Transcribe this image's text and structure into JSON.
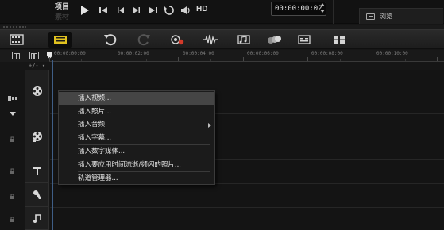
{
  "colors": {
    "accent": "#e1c21f",
    "playhead": "#3f5e86",
    "background": "#161616",
    "menu_hover": "#454545"
  },
  "top_bar": {
    "mode_label": "项目",
    "mode_label_sub": "素材",
    "hd_label": "HD",
    "timecode": "00:00:00:02",
    "browse_label": "浏览",
    "controls": [
      {
        "icon": "play-icon"
      },
      {
        "icon": "go-to-start-icon"
      },
      {
        "icon": "previous-frame-icon"
      },
      {
        "icon": "next-frame-icon"
      },
      {
        "icon": "go-to-end-icon"
      },
      {
        "icon": "repeat-icon"
      },
      {
        "icon": "volume-icon"
      }
    ]
  },
  "toolbar": {
    "items": [
      {
        "icon": "storyboard-view-icon",
        "active": false
      },
      {
        "icon": "timeline-view-icon",
        "active": true
      },
      {
        "icon": "undo-icon",
        "active": false
      },
      {
        "icon": "redo-icon",
        "active": false
      },
      {
        "icon": "record-capture-icon",
        "active": false
      },
      {
        "icon": "audio-mixer-icon",
        "active": false
      },
      {
        "icon": "auto-music-icon",
        "active": false
      },
      {
        "icon": "motion-track-icon",
        "active": false
      },
      {
        "icon": "subtitle-editor-icon",
        "active": false
      },
      {
        "icon": "multi-camera-icon",
        "active": false
      }
    ]
  },
  "ruler": {
    "zoom_hint": "+/- ▾",
    "ticks": [
      "00:00:00:00",
      "00:00:02:00",
      "00:00:04:00",
      "00:00:06:00",
      "00:00:08:00",
      "00:00:10:00"
    ]
  },
  "tracks": [
    {
      "icon": "video-track-icon"
    },
    {
      "icon": "overlay-track-icon"
    },
    {
      "icon": "title-track-icon"
    },
    {
      "icon": "voice-track-icon"
    },
    {
      "icon": "music-track-icon"
    }
  ],
  "context_menu": {
    "items": [
      {
        "label": "插入视频...",
        "hover": true
      },
      {
        "label": "插入照片..."
      },
      {
        "label": "插入音频",
        "submenu": true
      },
      {
        "label": "插入字幕..."
      },
      {
        "separator": true
      },
      {
        "label": "插入数字媒体..."
      },
      {
        "label": "插入要应用时间流逝/频闪的照片..."
      },
      {
        "separator": true
      },
      {
        "label": "轨道管理器..."
      }
    ]
  }
}
